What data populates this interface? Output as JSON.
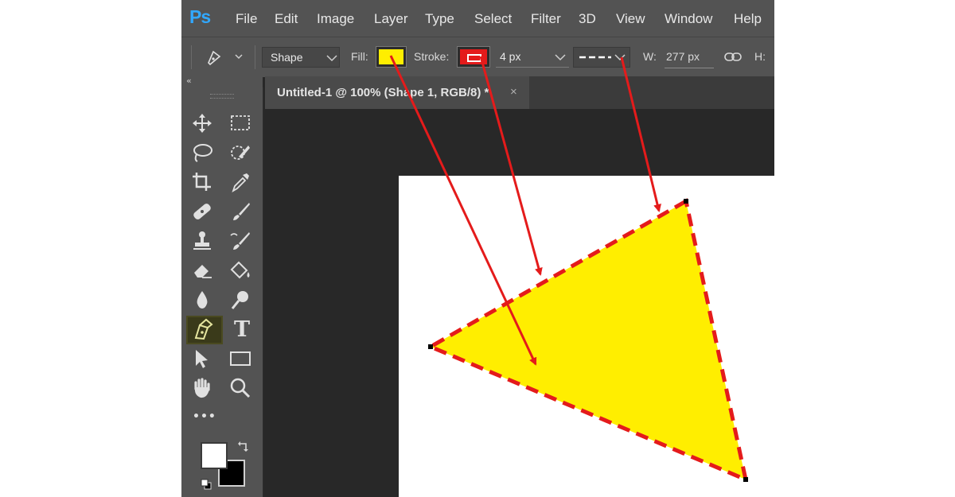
{
  "app": {
    "logo": "Ps"
  },
  "menu": [
    "File",
    "Edit",
    "Image",
    "Layer",
    "Type",
    "Select",
    "Filter",
    "3D",
    "View",
    "Window",
    "Help"
  ],
  "options": {
    "mode": "Shape",
    "fill_label": "Fill:",
    "fill_color": "#ffee00",
    "stroke_label": "Stroke:",
    "stroke_color": "#e41b1b",
    "stroke_width": "4 px",
    "stroke_style": "dashed",
    "w_label": "W:",
    "w_value": "277 px",
    "h_label": "H:"
  },
  "document": {
    "tab_title": "Untitled-1 @ 100% (Shape 1, RGB/8) *",
    "close": "×"
  },
  "toolbar": {
    "collapse": "«",
    "tools": [
      "move-tool",
      "marquee-tool",
      "lasso-tool",
      "quick-select-tool",
      "crop-tool",
      "eyedropper-tool",
      "healing-brush-tool",
      "brush-tool",
      "clone-stamp-tool",
      "history-brush-tool",
      "eraser-tool",
      "paint-bucket-tool",
      "blur-tool",
      "dodge-tool",
      "pen-tool",
      "type-tool",
      "path-selection-tool",
      "rectangle-tool",
      "hand-tool",
      "zoom-tool",
      "edit-toolbar"
    ],
    "active_tool": "pen-tool",
    "type_glyph": "T",
    "more_glyph": "•••",
    "foreground_color": "#ffffff",
    "background_color": "#000000"
  },
  "canvas": {
    "background": "#ffffff",
    "shape_fill": "#ffee00",
    "shape_stroke": "#e41b1b",
    "arrow_color": "#e41b1b"
  }
}
